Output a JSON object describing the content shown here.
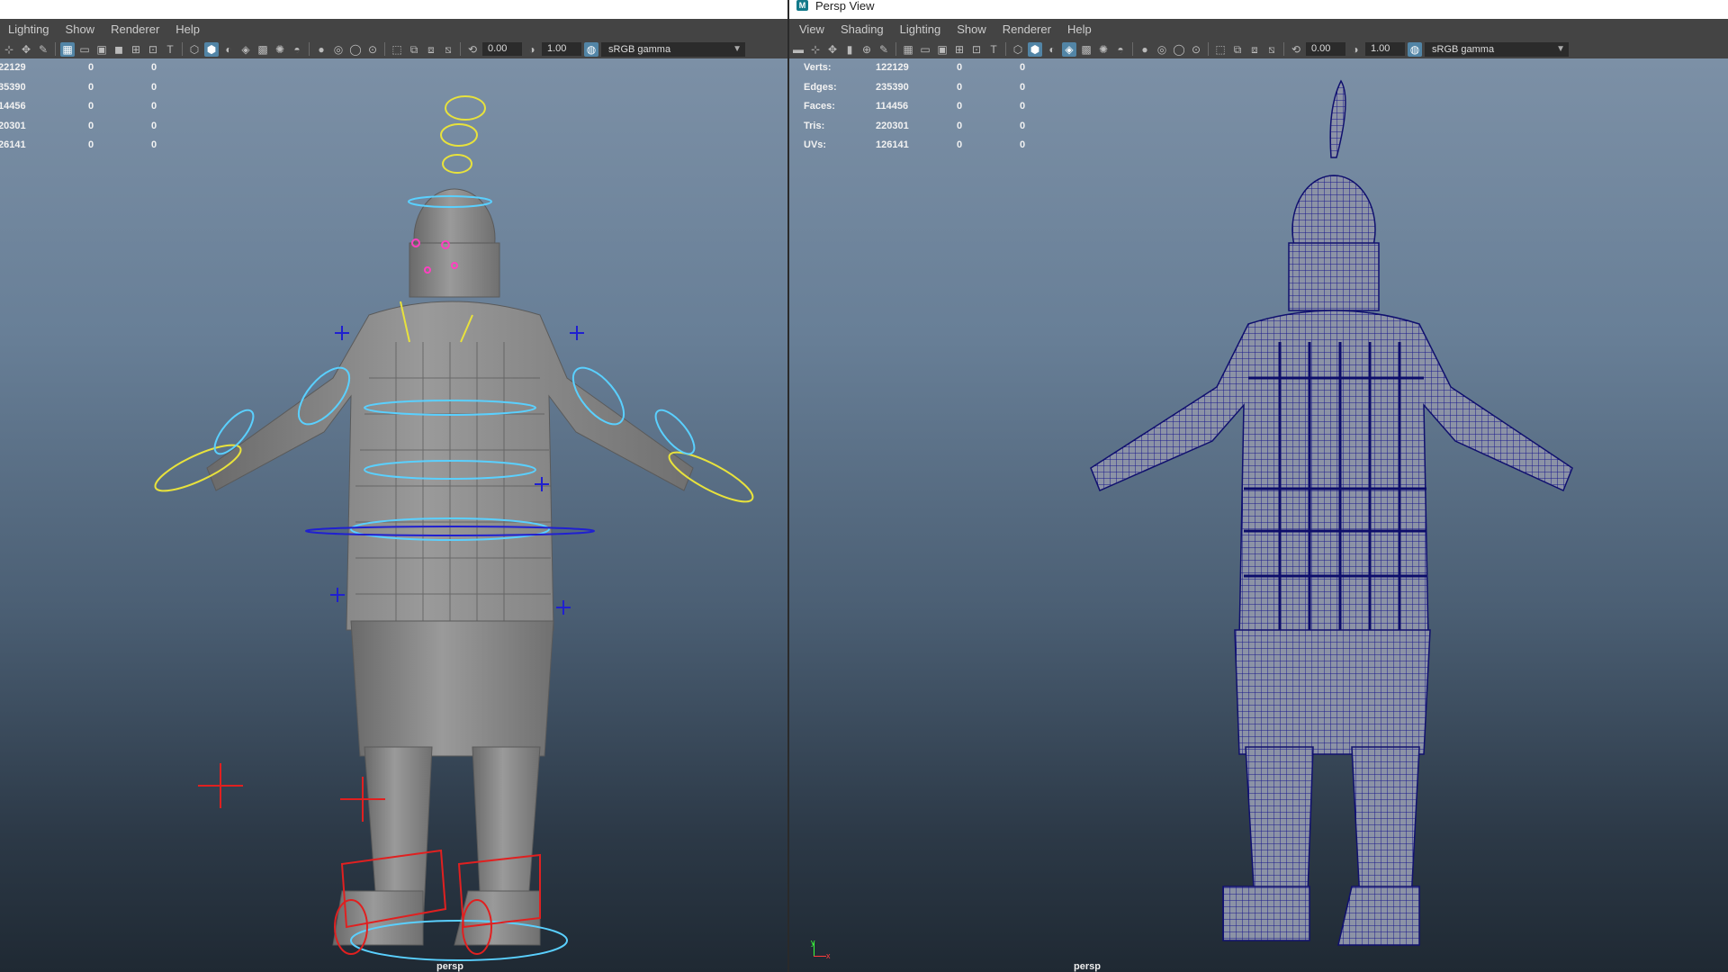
{
  "left_panel": {
    "title": "",
    "menu": [
      "Lighting",
      "Show",
      "Renderer",
      "Help"
    ],
    "toolbar": {
      "exposure": "0.00",
      "gamma": "1.00",
      "color_management": "sRGB gamma"
    },
    "stats": [
      {
        "v1": "22129",
        "v2": "0",
        "v3": "0"
      },
      {
        "v1": "35390",
        "v2": "0",
        "v3": "0"
      },
      {
        "v1": "14456",
        "v2": "0",
        "v3": "0"
      },
      {
        "v1": "20301",
        "v2": "0",
        "v3": "0"
      },
      {
        "v1": "26141",
        "v2": "0",
        "v3": "0"
      }
    ],
    "camera": "persp"
  },
  "right_panel": {
    "title": "Persp View",
    "menu": [
      "View",
      "Shading",
      "Lighting",
      "Show",
      "Renderer",
      "Help"
    ],
    "toolbar": {
      "exposure": "0.00",
      "gamma": "1.00",
      "color_management": "sRGB gamma"
    },
    "stats": [
      {
        "label": "Verts:",
        "v1": "122129",
        "v2": "0",
        "v3": "0"
      },
      {
        "label": "Edges:",
        "v1": "235390",
        "v2": "0",
        "v3": "0"
      },
      {
        "label": "Faces:",
        "v1": "114456",
        "v2": "0",
        "v3": "0"
      },
      {
        "label": "Tris:",
        "v1": "220301",
        "v2": "0",
        "v3": "0"
      },
      {
        "label": "UVs:",
        "v1": "126141",
        "v2": "0",
        "v3": "0"
      }
    ],
    "camera": "persp",
    "axis": {
      "y": "y",
      "x": "x"
    }
  },
  "colors": {
    "wire": "#1a1a8c",
    "ctrl_yellow": "#e8e23c",
    "ctrl_cyan": "#5ad0ff",
    "ctrl_red": "#e02020",
    "ctrl_blue": "#2020d0"
  }
}
